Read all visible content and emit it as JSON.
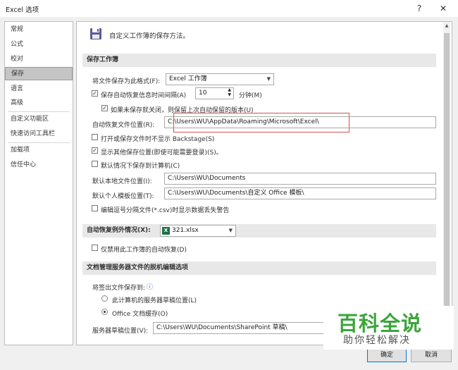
{
  "window": {
    "title": "Excel 选项",
    "help": "?",
    "close": "✕"
  },
  "sidebar": {
    "items": [
      {
        "label": "常规"
      },
      {
        "label": "公式"
      },
      {
        "label": "校对"
      },
      {
        "label": "保存"
      },
      {
        "label": "语言"
      },
      {
        "label": "高级"
      },
      {
        "label": "自定义功能区"
      },
      {
        "label": "快速访问工具栏"
      },
      {
        "label": "加载项"
      },
      {
        "label": "信任中心"
      }
    ],
    "selected": "保存"
  },
  "header": {
    "text": "自定义工作簿的保存方法。",
    "icon": "floppy-disk-icon"
  },
  "save_workbooks": {
    "heading": "保存工作簿",
    "format_label": "将文件保存为此格式(F):",
    "format_value": "Excel 工作簿",
    "autorecover_label": "保存自动恢复信息时间间隔(A)",
    "autorecover_checked": true,
    "autorecover_minutes": "10",
    "minutes_label": "分钟(M)",
    "keep_last_label": "如果未保存就关闭，则保留上次自动保留的版本(U)",
    "keep_last_checked": true,
    "autorecover_location_label": "自动恢复文件位置(R):",
    "autorecover_location": "C:\\Users\\WU\\AppData\\Roaming\\Microsoft\\Excel\\",
    "no_backstage_label": "打开或保存文件时不显示 Backstage(S)",
    "no_backstage_checked": false,
    "show_additional_label": "显示其他保存位置(即使可能需要登录)(S)。",
    "show_additional_checked": true,
    "save_to_computer_label": "默认情况下保存到计算机(C)",
    "save_to_computer_checked": false,
    "default_local_label": "默认本地文件位置(I):",
    "default_local": "C:\\Users\\WU\\Documents",
    "personal_templates_label": "默认个人模板位置(T):",
    "personal_templates": "C:\\Users\\WU\\Documents\\自定义 Office 模板\\",
    "csv_warning_label": "编辑逗号分隔文件(*.csv)时显示数据丢失警告",
    "csv_warning_checked": false
  },
  "autorecover_exceptions": {
    "heading": "自动恢复例外情况(X):",
    "file": "321.xlsx",
    "disable_label": "仅禁用此工作簿的自动恢复(D)",
    "disable_checked": false
  },
  "offline_editing": {
    "heading": "文档管理服务器文件的脱机编辑选项",
    "save_checked_out_label": "将签出文件保存到:",
    "info_icon": "ⓘ",
    "option_server_drafts": "此计算机的服务器草稿位置(L)",
    "option_office_cache": "Office 文档缓存(O)",
    "selected": "Office 文档缓存(O)",
    "server_drafts_label": "服务器草稿位置(V):",
    "server_drafts": "C:\\Users\\WU\\Documents\\SharePoint 草稿\\"
  },
  "buttons": {
    "ok": "确定",
    "cancel": "取消"
  },
  "watermark": {
    "big": "百科全说",
    "small": "助你轻松解决"
  },
  "colors": {
    "accent": "#0078d7",
    "highlight_box": "#d9534f",
    "watermark": "#3ba53b",
    "excel_green": "#1e7145"
  }
}
